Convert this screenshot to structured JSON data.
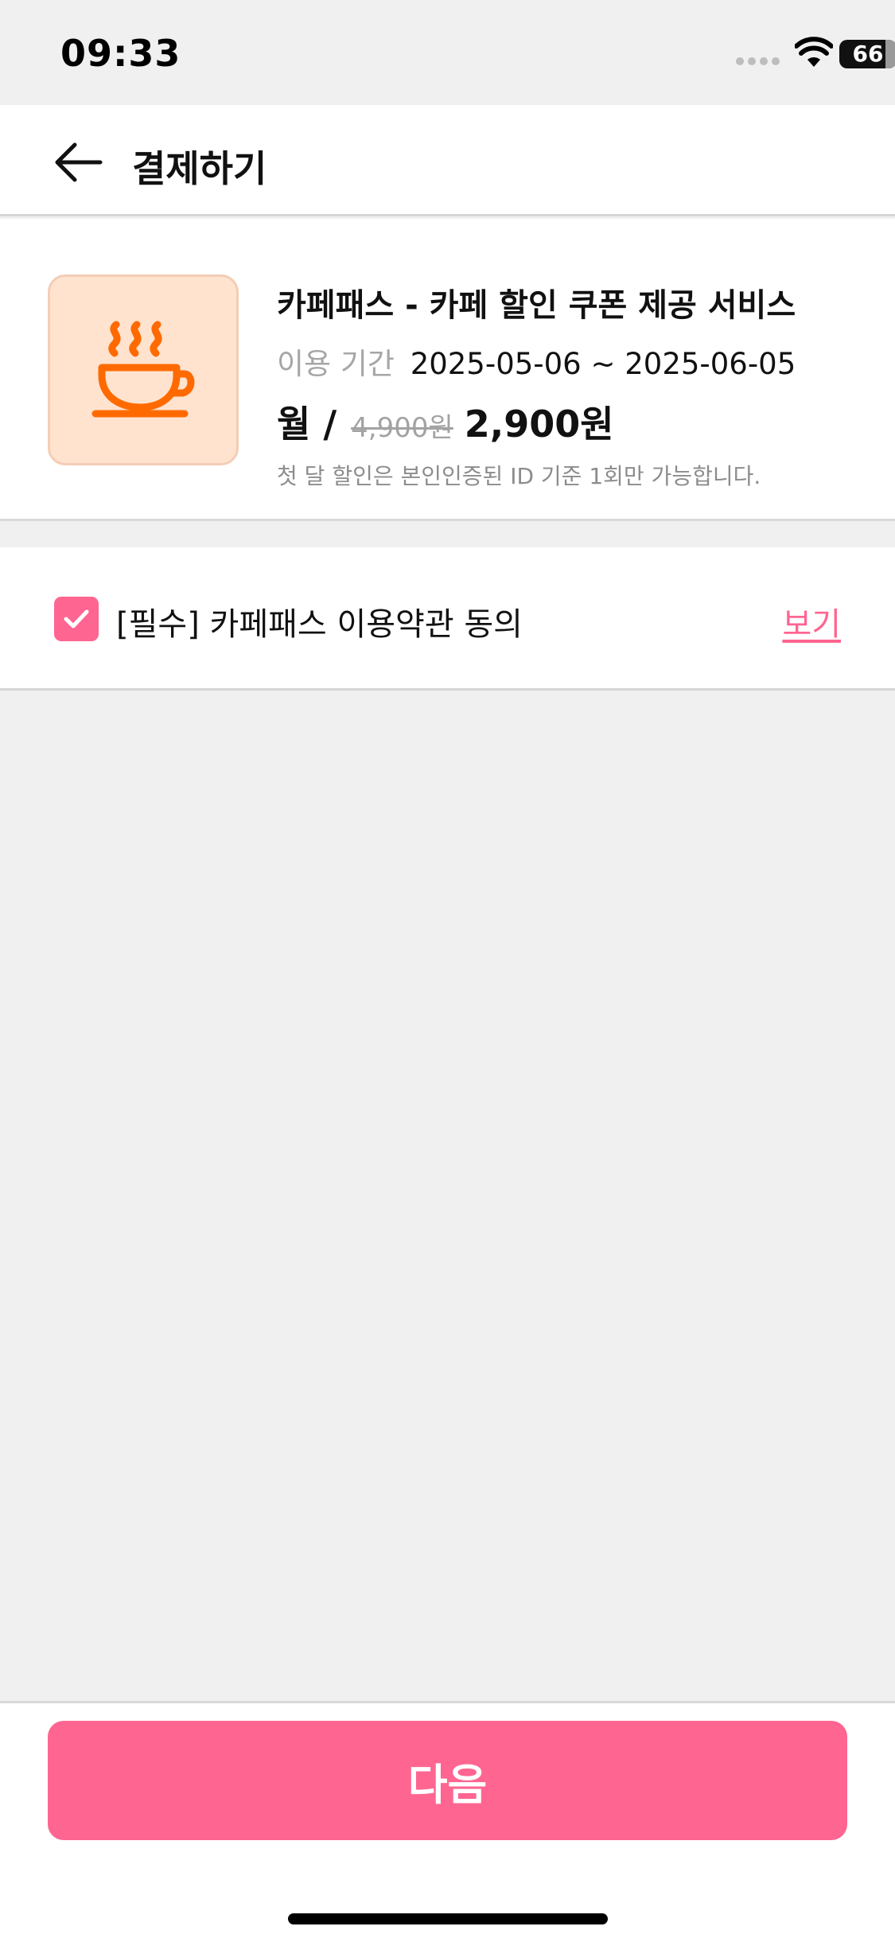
{
  "status_bar": {
    "time": "09:33",
    "battery": "66",
    "icons": [
      "signal-dots-icon",
      "wifi-icon",
      "battery-icon"
    ]
  },
  "header": {
    "back_icon": "arrow-left-icon",
    "title": "결제하기"
  },
  "product": {
    "icon": "coffee-cup-icon",
    "name": "카페패스 - 카페 할인 쿠폰 제공 서비스",
    "period_label": "이용 기간",
    "period_value": "2025-05-06 ~ 2025-06-05",
    "price_unit": "월 /",
    "original_price": "4,900원",
    "final_price": "2,900원",
    "note": "첫 달 할인은 본인인증된 ID 기준 1회만 가능합니다."
  },
  "agreement": {
    "checked": true,
    "label": "[필수] 카페패스 이용약관 동의",
    "view_label": "보기"
  },
  "footer": {
    "next_label": "다음"
  },
  "colors": {
    "accent": "#FF6591",
    "thumb_bg": "#FFE3CF",
    "cup": "#FF6A00",
    "background": "#F0F0F0"
  }
}
